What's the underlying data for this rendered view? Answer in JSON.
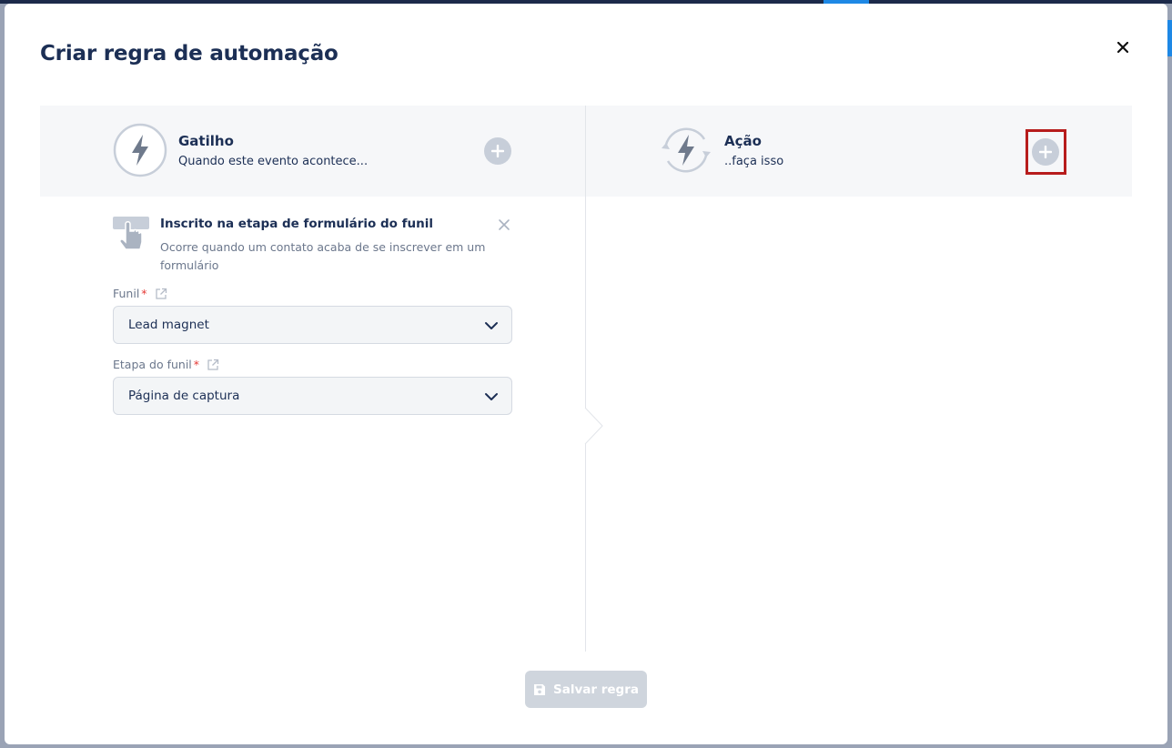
{
  "modal": {
    "title": "Criar regra de automação"
  },
  "trigger": {
    "title": "Gatilho",
    "subtitle": "Quando este evento acontece..."
  },
  "action": {
    "title": "Ação",
    "subtitle": "..faça isso"
  },
  "trigger_card": {
    "title": "Inscrito na etapa de formulário do funil",
    "description": "Ocorre quando um contato acaba de se inscrever em um formulário"
  },
  "fields": {
    "funnel": {
      "label": "Funil",
      "required_mark": "*",
      "value": "Lead magnet"
    },
    "funnel_step": {
      "label": "Etapa do funil",
      "required_mark": "*",
      "value": "Página de captura"
    }
  },
  "footer": {
    "save_label": "Salvar regra"
  },
  "colors": {
    "primary_text": "#1c2f55",
    "muted_text": "#6b778c",
    "icon_gray": "#6f7a8c",
    "disabled": "#cfd5dd",
    "highlight": "#b71c1c",
    "required": "#e53935"
  },
  "icons": {
    "trigger": "lightning-icon",
    "action": "lightning-cycle-icon",
    "add": "plus-circle-icon",
    "close": "close-icon",
    "external": "external-link-icon",
    "chevron": "chevron-down-icon",
    "save": "floppy-disk-icon",
    "card": "hand-pointer-icon"
  }
}
